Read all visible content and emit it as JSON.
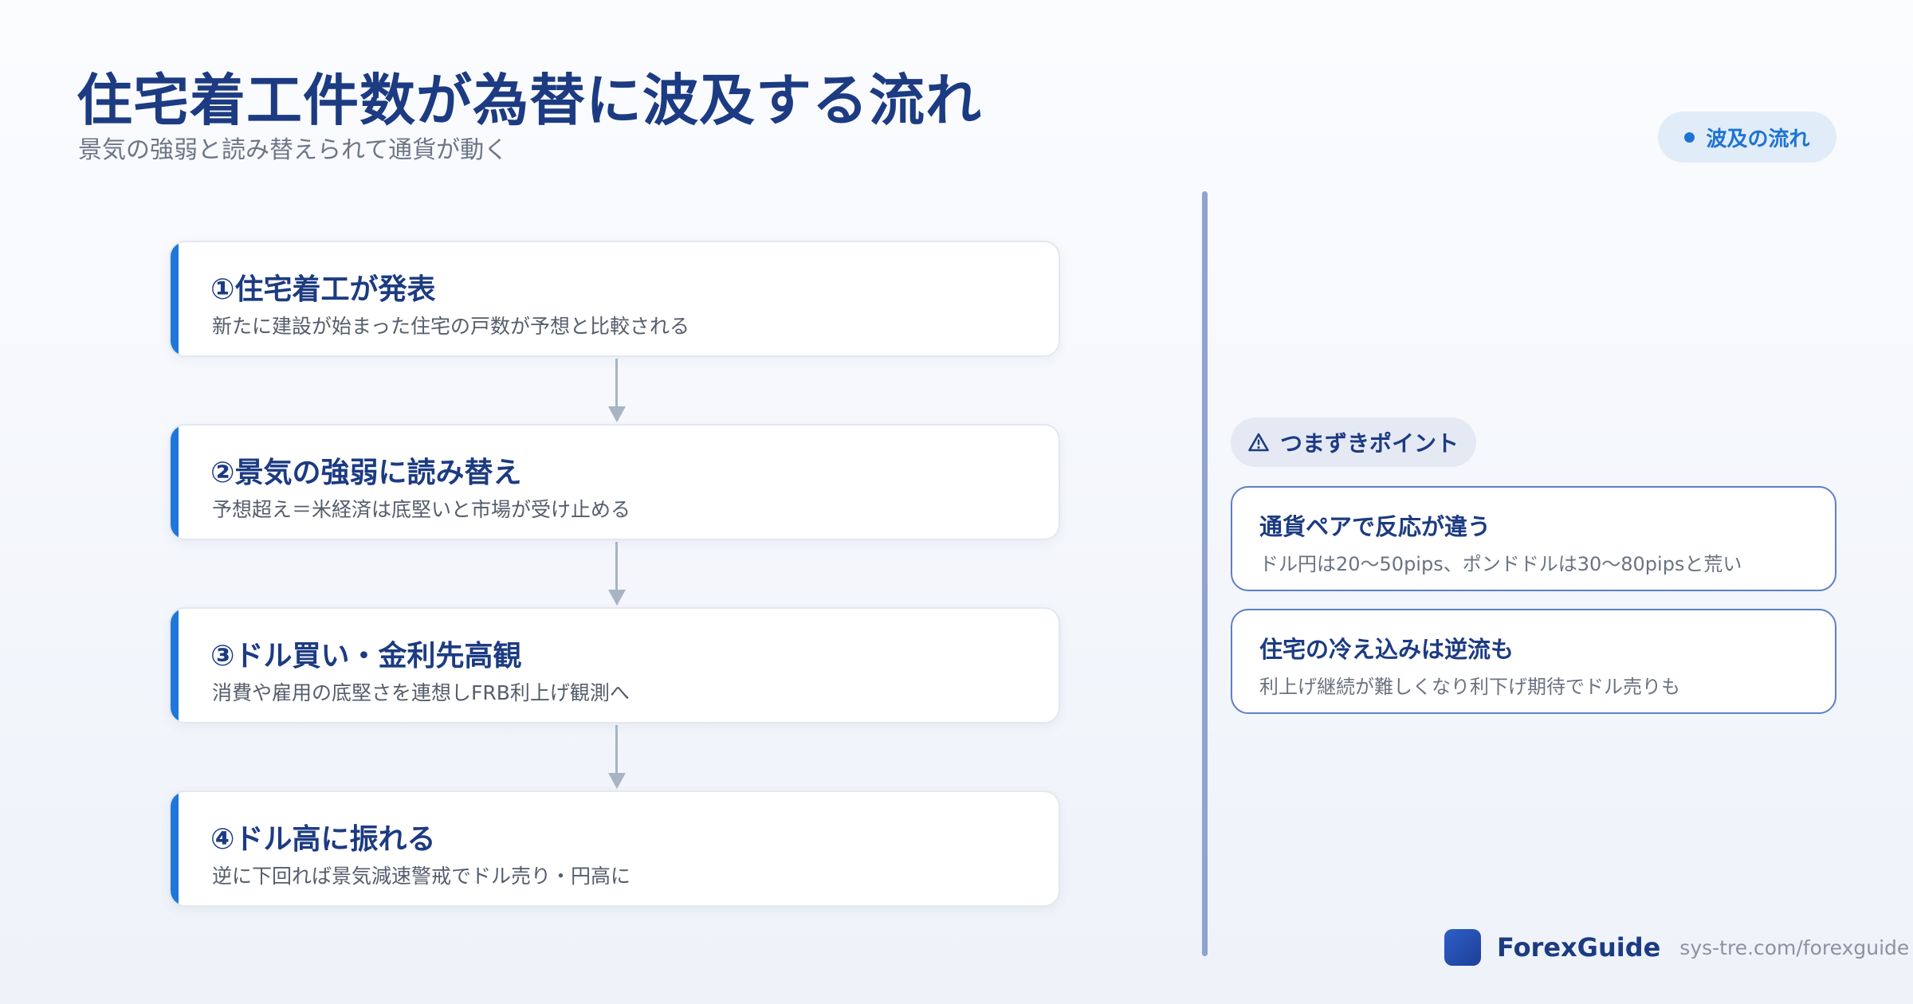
{
  "header": {
    "title": "住宅着工件数が為替に波及する流れ",
    "subtitle": "景気の強弱と読み替えられて通貨が動く",
    "badge_label": "波及の流れ"
  },
  "steps": [
    {
      "title": "①住宅着工が発表",
      "desc": "新たに建設が始まった住宅の戸数が予想と比較される"
    },
    {
      "title": "②景気の強弱に読み替え",
      "desc": "予想超え＝米経済は底堅いと市場が受け止める"
    },
    {
      "title": "③ドル買い・金利先高観",
      "desc": "消費や雇用の底堅さを連想しFRB利上げ観測へ"
    },
    {
      "title": "④ドル高に振れる",
      "desc": "逆に下回れば景気減速警戒でドル売り・円高に"
    }
  ],
  "pitfalls": {
    "heading": "つまずきポイント",
    "items": [
      {
        "title": "通貨ペアで反応が違う",
        "desc": "ドル円は20〜50pips、ポンドドルは30〜80pipsと荒い"
      },
      {
        "title": "住宅の冷え込みは逆流も",
        "desc": "利上げ継続が難しくなり利下げ期待でドル売りも"
      }
    ]
  },
  "footer": {
    "brand": "ForexGuide",
    "url": "sys-tre.com/forexguide"
  },
  "colors": {
    "accent": "#1f78d8",
    "title": "#1c3b82",
    "divider": "#8fa3d1",
    "card_border": "#5e7fc4"
  }
}
